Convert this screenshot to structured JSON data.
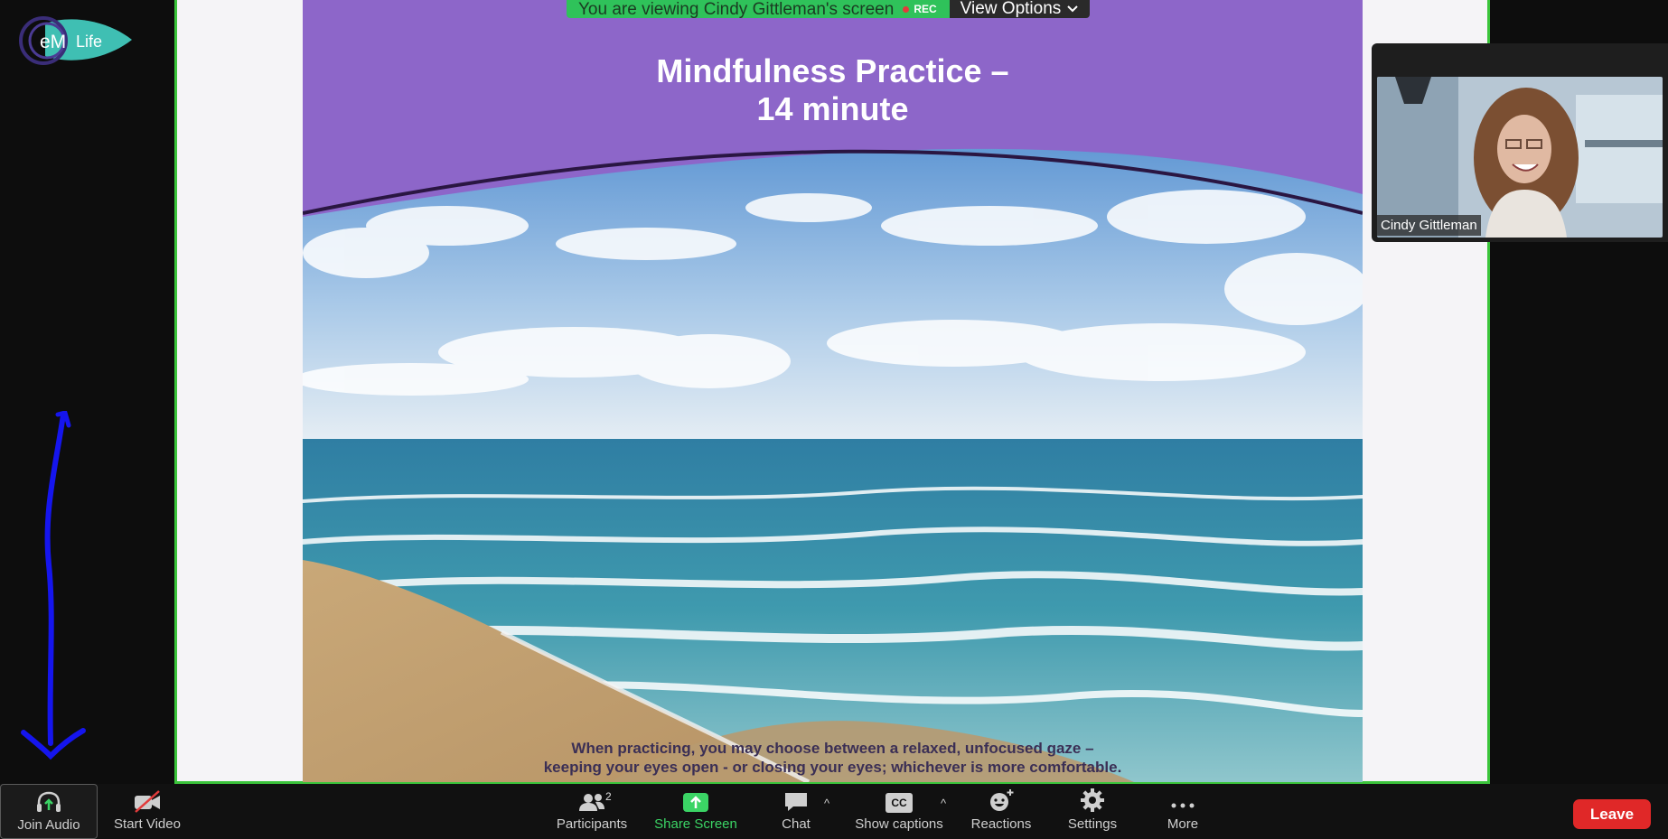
{
  "app": {
    "logo_text": "eM Life"
  },
  "banner": {
    "viewing_text": "You are viewing Cindy Gittleman's screen",
    "rec_label": "REC",
    "view_options_label": "View Options"
  },
  "slide": {
    "title_line1": "Mindfulness Practice –",
    "title_line2": "14 minute",
    "caption_line1": "When practicing, you may choose between a relaxed, unfocused gaze –",
    "caption_line2": "keeping your eyes open - or closing your eyes; whichever is more comfortable."
  },
  "participant": {
    "name": "Cindy Gittleman"
  },
  "toolbar": {
    "join_audio": "Join Audio",
    "start_video": "Start Video",
    "participants": "Participants",
    "participants_count": "2",
    "share_screen": "Share Screen",
    "chat": "Chat",
    "show_captions": "Show captions",
    "captions_icon_text": "CC",
    "reactions": "Reactions",
    "settings": "Settings",
    "more": "More",
    "leave": "Leave"
  },
  "colors": {
    "accent_green": "#3bc43b",
    "slide_purple": "#8d66c9",
    "leave_red": "#e02828",
    "annotation_blue": "#1515ee"
  }
}
